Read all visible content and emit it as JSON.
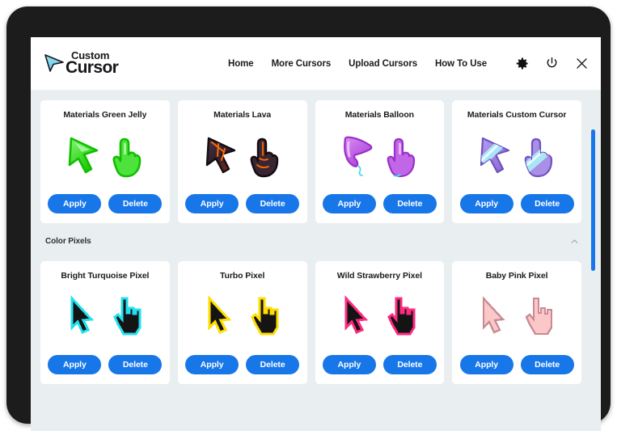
{
  "header": {
    "logo_top": "Custom",
    "logo_bottom": "Cursor",
    "logo_icon": "cursor-arrow-gradient-icon",
    "nav": [
      {
        "label": "Home"
      },
      {
        "label": "More Cursors"
      },
      {
        "label": "Upload Cursors"
      },
      {
        "label": "How To Use"
      }
    ],
    "icons": [
      {
        "name": "gear-icon"
      },
      {
        "name": "power-icon"
      },
      {
        "name": "close-icon"
      }
    ]
  },
  "buttons": {
    "apply": "Apply",
    "delete": "Delete"
  },
  "colors": {
    "accent_blue": "#1877E8",
    "page_bg": "#e9eef0",
    "card_bg": "#ffffff",
    "frame": "#1c1c1c",
    "text": "#1b1b20"
  },
  "rows": [
    {
      "section": null,
      "cards": [
        {
          "title": "Materials Green Jelly",
          "style": "green-jelly"
        },
        {
          "title": "Materials Lava",
          "style": "lava"
        },
        {
          "title": "Materials Balloon",
          "style": "balloon"
        },
        {
          "title": "Materials Custom Cursor",
          "style": "custom-cursor"
        }
      ]
    },
    {
      "section": {
        "title": "Color Pixels",
        "collapse_icon": "chevron-up-icon"
      },
      "cards": [
        {
          "title": "Bright Turquoise Pixel",
          "style": "pixel-turquoise"
        },
        {
          "title": "Turbo Pixel",
          "style": "pixel-yellow"
        },
        {
          "title": "Wild Strawberry Pixel",
          "style": "pixel-strawberry"
        },
        {
          "title": "Baby Pink Pixel",
          "style": "pixel-babypink"
        }
      ]
    }
  ],
  "scrollbar": {
    "name": "vertical-scrollbar"
  }
}
